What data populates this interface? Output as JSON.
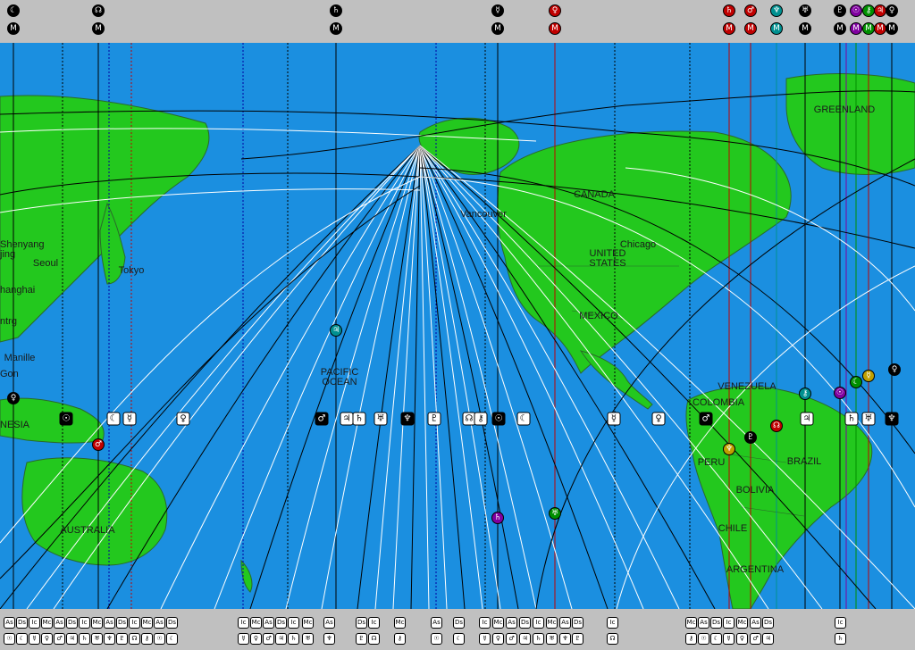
{
  "colors": {
    "ocean": "#1b8fe0",
    "land": "#23c81e",
    "border": "#2a6a2a",
    "band": "#c0c0c0",
    "line_black": "#000000",
    "line_white": "#ffffff",
    "line_red": "#d00000",
    "line_blue": "#0000a0"
  },
  "map_labels": {
    "greenland": "GREENLAND",
    "canada": "CANADA",
    "vancouver": "Vancouver",
    "chicago": "Chicago",
    "united_states": "UNITED\nSTATES",
    "mexico": "MEXICO",
    "venezuela": "VENEZUELA",
    "colombia": "COLOMBIA",
    "peru": "PERU",
    "brazil": "BRAZIL",
    "bolivia": "BOLIVIA",
    "chile": "CHILE",
    "argentina": "ARGENTINA",
    "pacific_ocean": "PACIFIC\nOCEAN",
    "australia": "AUSTRALIA",
    "tokyo": "Tokyo",
    "seoul": "Seoul",
    "shenyang": "Shenyang",
    "beijing": "jing",
    "shanghai": "hanghai",
    "chengdu": "ntrg",
    "manila": "Manille",
    "saigon": "Gon",
    "indonesia": "NESIA"
  },
  "top_markers": [
    {
      "symbol": "☾",
      "sub": "M",
      "color": "#000000"
    },
    {
      "symbol": "☊",
      "sub": "M",
      "color": "#000000"
    },
    {
      "symbol": "♄",
      "sub": "M",
      "color": "#000000"
    },
    {
      "symbol": "☿",
      "sub": "M",
      "color": "#000000"
    },
    {
      "symbol": "♀",
      "sub": "M",
      "color": "#c00000"
    },
    {
      "symbol": "♄",
      "sub": "M",
      "color": "#c00000"
    },
    {
      "symbol": "♂",
      "sub": "M",
      "color": "#c00000"
    },
    {
      "symbol": "♆",
      "sub": "M",
      "color": "#009090"
    },
    {
      "symbol": "♅",
      "sub": "M",
      "color": "#000000"
    },
    {
      "symbol": "♇",
      "sub": "M",
      "color": "#000000"
    },
    {
      "symbol": "☉",
      "sub": "M",
      "color": "#8000a0"
    },
    {
      "symbol": "⚷",
      "sub": "M",
      "color": "#009000"
    },
    {
      "symbol": "♃",
      "sub": "M",
      "color": "#c00000"
    },
    {
      "symbol": "♀",
      "sub": "M",
      "color": "#000000"
    }
  ],
  "bottom_labels": [
    "As",
    "Ds",
    "Ic",
    "Mc"
  ],
  "bottom_symbols": [
    "☉",
    "☾",
    "☿",
    "♀",
    "♂",
    "♃",
    "♄",
    "♅",
    "♆",
    "♇",
    "☊",
    "⚷"
  ]
}
